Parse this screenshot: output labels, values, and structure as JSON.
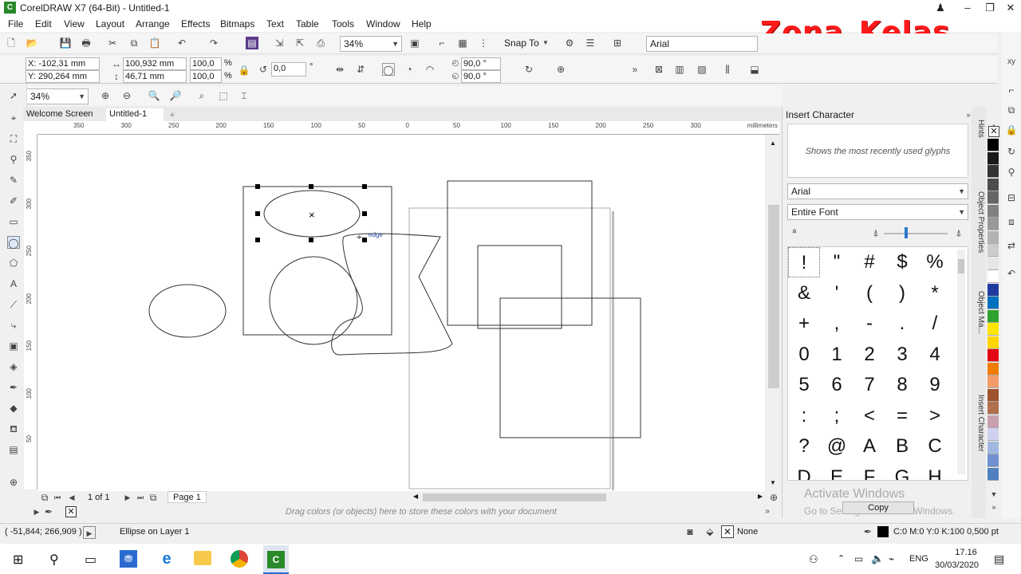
{
  "window": {
    "title": "CorelDRAW X7 (64-Bit) - Untitled-1"
  },
  "watermark": "Zona_Kelas",
  "menu": [
    "File",
    "Edit",
    "View",
    "Layout",
    "Arrange",
    "Effects",
    "Bitmaps",
    "Text",
    "Table",
    "Tools",
    "Window",
    "Help"
  ],
  "toolbar": {
    "zoom": "34%",
    "snap_label": "Snap To",
    "font": "Arial"
  },
  "property_bar": {
    "x": "X: -102,31 mm",
    "y": "Y: 290,264 mm",
    "width": "100,932 mm",
    "height": "46,71 mm",
    "scale_w": "100,0",
    "scale_h": "100,0",
    "pct": "%",
    "angle": "0,0",
    "deg": "°",
    "arc1": "90,0 °",
    "arc2": "90,0 °"
  },
  "toolbar3": {
    "zoom": "34%"
  },
  "tabs": [
    "Welcome Screen",
    "Untitled-1"
  ],
  "ruler": {
    "h_labels": [
      "350",
      "300",
      "250",
      "200",
      "150",
      "100",
      "50",
      "0",
      "50",
      "100",
      "150",
      "200",
      "250",
      "300"
    ],
    "unit": "millimeters",
    "v_labels": [
      "350",
      "300",
      "250",
      "200",
      "150",
      "100",
      "50"
    ]
  },
  "canvas": {
    "snap_hint": "edge"
  },
  "page_nav": {
    "count": "1 of 1",
    "page": "Page 1"
  },
  "color_bar_hint": "Drag colors (or objects) here to store these colors with your document",
  "status": {
    "coords": "( -51,844; 266,909 )",
    "object": "Ellipse on Layer 1",
    "fill": "None",
    "outline": "C:0 M:0 Y:0 K:100  0,500 pt"
  },
  "docker": {
    "title": "Insert Character",
    "recent_hint": "Shows the most recently used glyphs",
    "font": "Arial",
    "subset": "Entire Font",
    "glyphs": [
      "!",
      "\"",
      "#",
      "$",
      "%",
      "&",
      "'",
      "(",
      ")",
      "*",
      "+",
      ",",
      "-",
      ".",
      "/",
      "0",
      "1",
      "2",
      "3",
      "4",
      "5",
      "6",
      "7",
      "8",
      "9",
      ":",
      ";",
      "<",
      "=",
      ">",
      "?",
      "@",
      "A",
      "B",
      "C",
      "D",
      "E",
      "F",
      "G",
      "H"
    ],
    "copy_label": "Copy",
    "activate1": "Activate Windows",
    "activate2": "Go to Settings to activate Windows."
  },
  "side_tabs": [
    "Hints",
    "Object Properties",
    "Object Ma...",
    "Insert Character"
  ],
  "palette": [
    "#000000",
    "#1a1a1a",
    "#333333",
    "#4d4d4d",
    "#666666",
    "#808080",
    "#999999",
    "#b3b3b3",
    "#cccccc",
    "#e6e6e6",
    "#ffffff",
    "#1e3aa0",
    "#0070c0",
    "#2fa22f",
    "#ffe600",
    "#ffd400",
    "#e30613",
    "#ef7d00",
    "#f39c6b",
    "#a0522d",
    "#b07050",
    "#c8a0b0",
    "#d0d0f0",
    "#a0b8e0",
    "#7090d0",
    "#5080c0"
  ],
  "taskbar": {
    "time": "17.16",
    "date": "30/03/2020",
    "lang": "ENG"
  }
}
